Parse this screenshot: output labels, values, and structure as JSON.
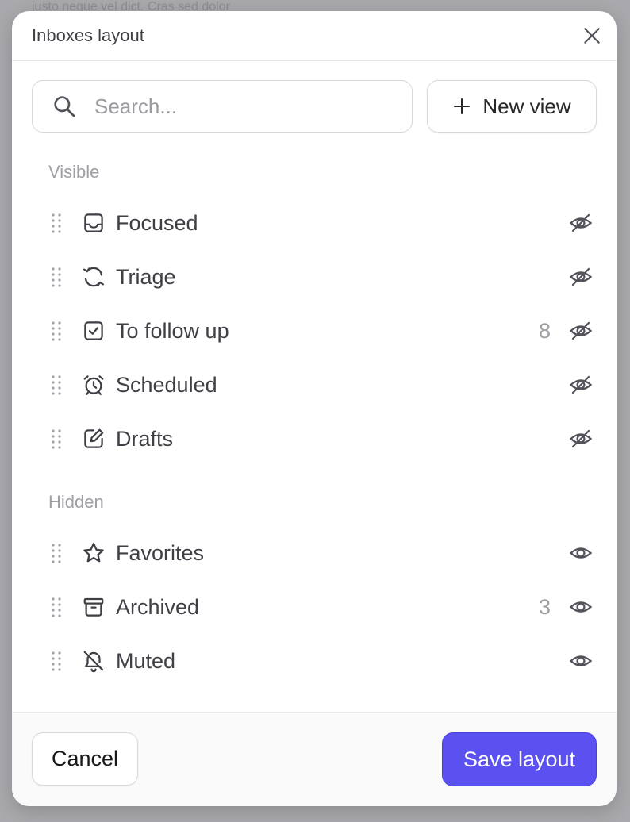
{
  "backdrop": {
    "text": "justo neque vel dict. Cras sed dolor"
  },
  "modal": {
    "title": "Inboxes layout"
  },
  "toolbar": {
    "search_placeholder": "Search...",
    "search_value": "",
    "new_view_label": "New view"
  },
  "sections": {
    "visible_label": "Visible",
    "hidden_label": "Hidden"
  },
  "visible_items": [
    {
      "label": "Focused",
      "icon": "inbox-tray-icon",
      "count": "",
      "visibility": "hide-eye-slash-icon"
    },
    {
      "label": "Triage",
      "icon": "refresh-cycle-icon",
      "count": "",
      "visibility": "hide-eye-slash-icon"
    },
    {
      "label": "To follow up",
      "icon": "checkbox-icon",
      "count": "8",
      "visibility": "hide-eye-slash-icon"
    },
    {
      "label": "Scheduled",
      "icon": "alarm-clock-icon",
      "count": "",
      "visibility": "hide-eye-slash-icon"
    },
    {
      "label": "Drafts",
      "icon": "edit-pencil-icon",
      "count": "",
      "visibility": "hide-eye-slash-icon"
    }
  ],
  "hidden_items": [
    {
      "label": "Favorites",
      "icon": "star-icon",
      "count": "",
      "visibility": "show-eye-icon"
    },
    {
      "label": "Archived",
      "icon": "archive-box-icon",
      "count": "3",
      "visibility": "show-eye-icon"
    },
    {
      "label": "Muted",
      "icon": "bell-slash-icon",
      "count": "",
      "visibility": "show-eye-icon"
    }
  ],
  "footer": {
    "cancel_label": "Cancel",
    "save_label": "Save layout"
  },
  "colors": {
    "accent": "#5b50f0",
    "overlay": "#a9a9ad",
    "text_primary": "#3f3f46",
    "text_muted": "#9e9ea5"
  }
}
